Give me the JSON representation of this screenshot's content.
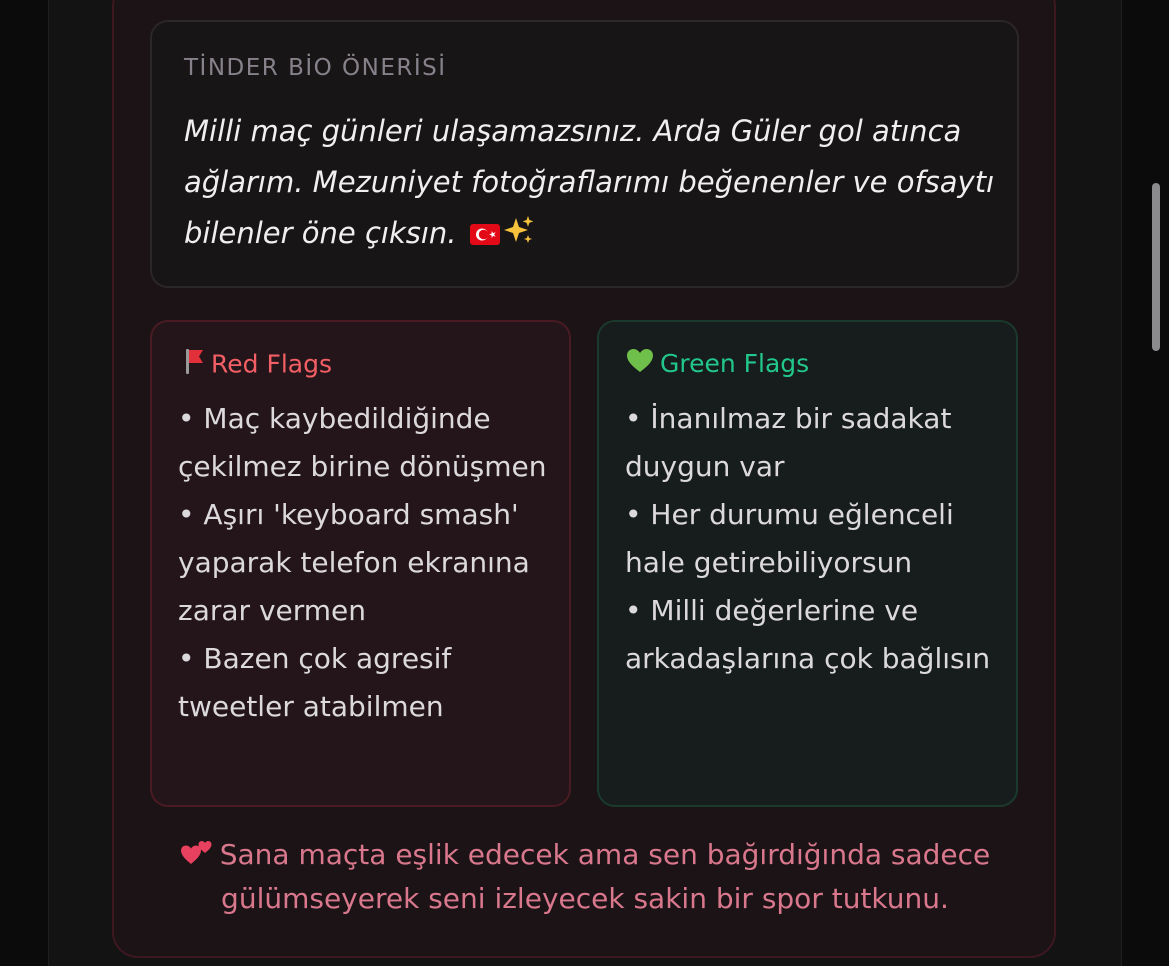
{
  "bio": {
    "label": "TİNDER BİO ÖNERİSİ",
    "text": "Milli maç günleri ulaşamazsınız. Arda Güler gol atınca ağlarım. Mezuniyet fotoğraflarımı beğenenler ve ofsaytı bilenler öne çıksın.",
    "emoji_icons": [
      "turkey-flag-icon",
      "sparkles-icon"
    ]
  },
  "red_flags": {
    "title": "Red Flags",
    "icon": "red-flag-icon",
    "items": [
      "• Maç kaybedildiğinde çekilmez birine dönüşmen",
      "• Aşırı 'keyboard smash' yaparak telefon ekranına zarar vermen",
      "• Bazen çok agresif tweetler atabilmen"
    ]
  },
  "green_flags": {
    "title": "Green Flags",
    "icon": "green-heart-icon",
    "items": [
      "• İnanılmaz bir sadakat duygun var",
      "• Her durumu eğlenceli hale getirebiliyorsun",
      "• Milli değerlerine ve arkadaşlarına çok bağlısın"
    ]
  },
  "footer": {
    "icon": "two-hearts-icon",
    "text": "Sana maçta eşlik edecek ama sen bağırdığında sadece gülümseyerek seni izleyecek sakin bir spor tutkunu."
  },
  "colors": {
    "red_accent": "#f25f65",
    "green_accent": "#22c78b",
    "footer_pink": "#d9778c"
  }
}
